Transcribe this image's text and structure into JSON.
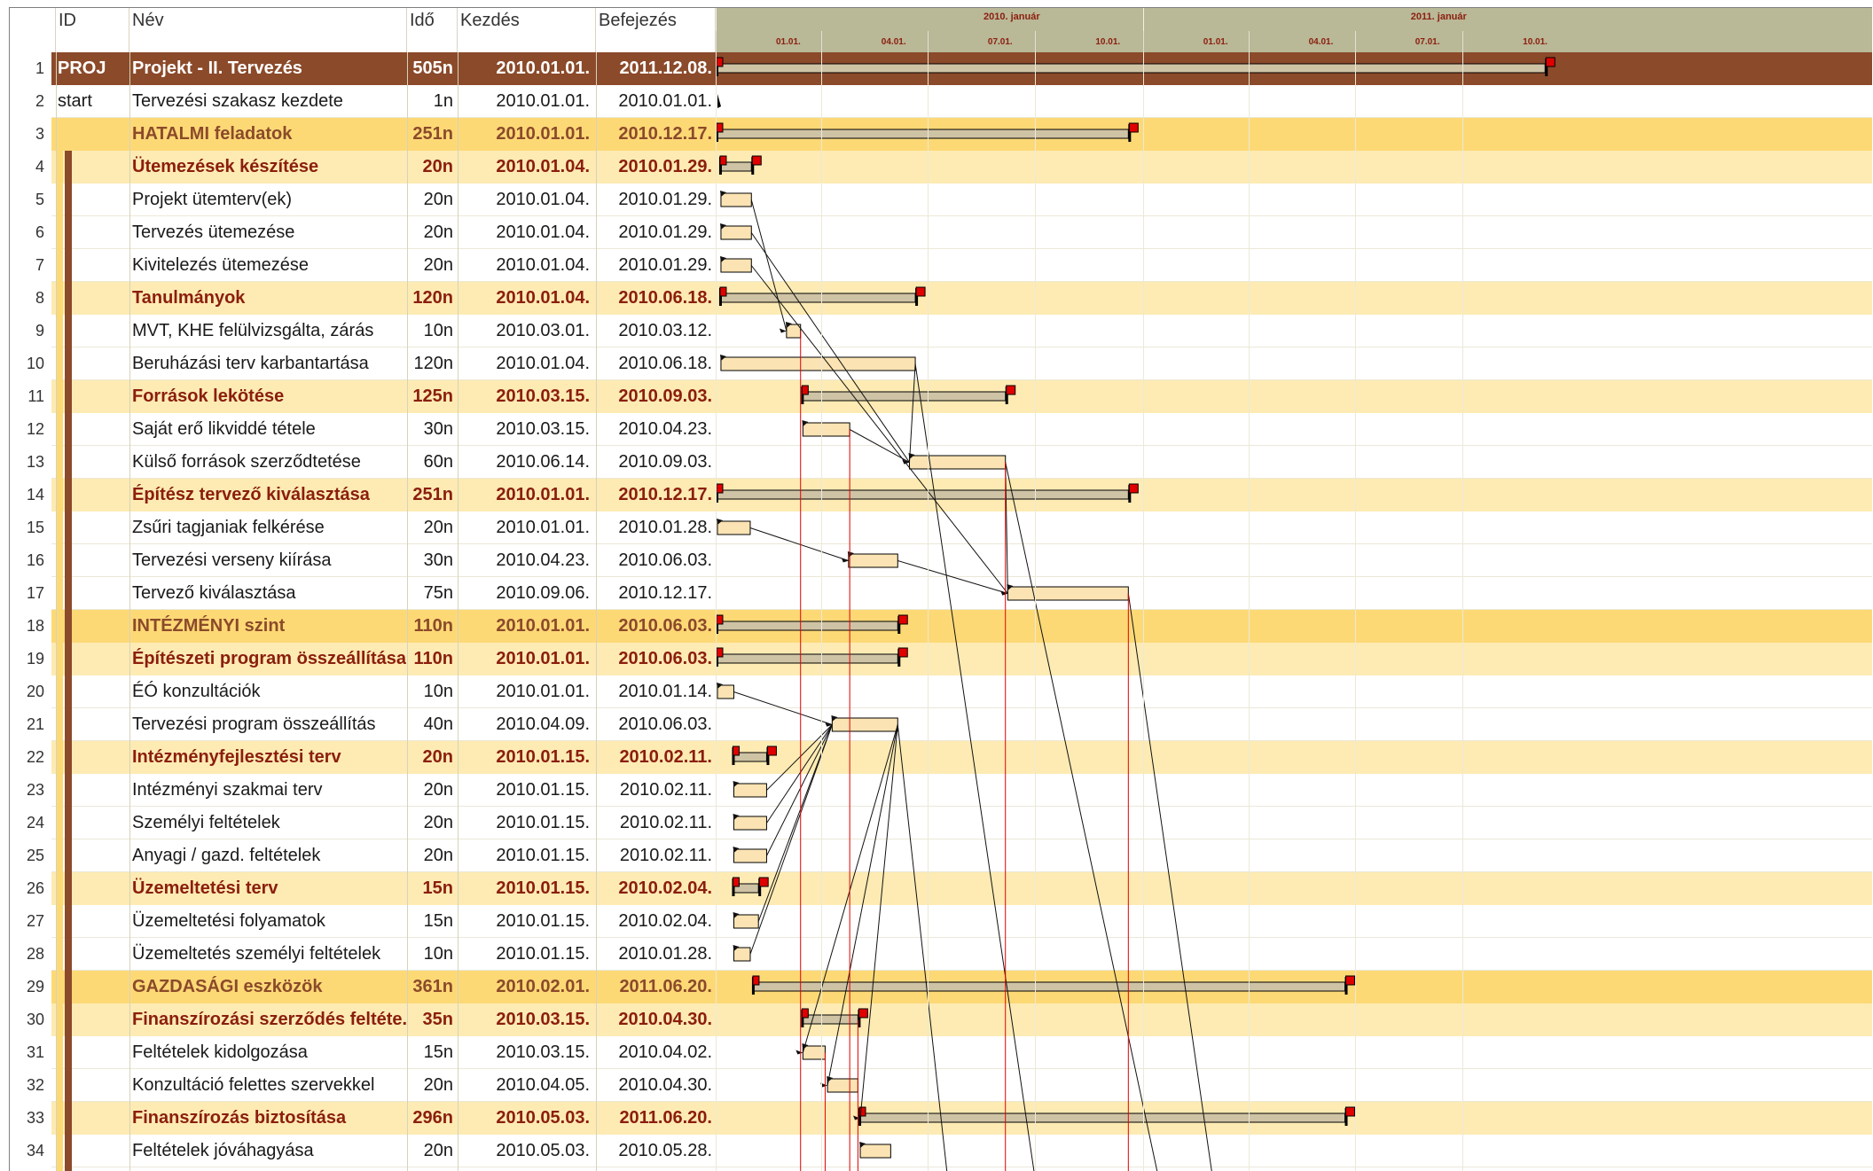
{
  "colors": {
    "project_row": "#8b4a2a",
    "main_group_row": "#fdd976",
    "sub_group_row": "#fdebb3",
    "sub_group_text": "#8b1e0e",
    "task_bar": "#fbe3b3",
    "summary_bar": "#cfc3a5",
    "milestone_flag": "#e00000",
    "timeline_bg": "#b9b897"
  },
  "header": {
    "id": "ID",
    "name": "Név",
    "duration": "Idő",
    "start": "Kezdés",
    "end": "Befejezés"
  },
  "timeline": {
    "years": [
      "2010. január",
      "2011. január"
    ],
    "months": [
      "01.01.",
      "04.01.",
      "07.01.",
      "10.01.",
      "01.01.",
      "04.01.",
      "07.01.",
      "10.01."
    ]
  },
  "rows": [
    {
      "num": "1",
      "id": "PROJ",
      "name": "Projekt - II. Tervezés",
      "dur": "505n",
      "start": "2010.01.01.",
      "end": "2011.12.08.",
      "type": "project"
    },
    {
      "num": "2",
      "id": "start",
      "name": "Tervezési szakasz kezdete",
      "dur": "1n",
      "start": "2010.01.01.",
      "end": "2010.01.01.",
      "type": "milestone"
    },
    {
      "num": "3",
      "id": "",
      "name": "HATALMI feladatok",
      "dur": "251n",
      "start": "2010.01.01.",
      "end": "2010.12.17.",
      "type": "main"
    },
    {
      "num": "4",
      "id": "",
      "name": "Ütemezések készítése",
      "dur": "20n",
      "start": "2010.01.04.",
      "end": "2010.01.29.",
      "type": "sub"
    },
    {
      "num": "5",
      "id": "",
      "name": "Projekt ütemterv(ek)",
      "dur": "20n",
      "start": "2010.01.04.",
      "end": "2010.01.29.",
      "type": "task"
    },
    {
      "num": "6",
      "id": "",
      "name": "Tervezés ütemezése",
      "dur": "20n",
      "start": "2010.01.04.",
      "end": "2010.01.29.",
      "type": "task"
    },
    {
      "num": "7",
      "id": "",
      "name": "Kivitelezés ütemezése",
      "dur": "20n",
      "start": "2010.01.04.",
      "end": "2010.01.29.",
      "type": "task"
    },
    {
      "num": "8",
      "id": "",
      "name": "Tanulmányok",
      "dur": "120n",
      "start": "2010.01.04.",
      "end": "2010.06.18.",
      "type": "sub"
    },
    {
      "num": "9",
      "id": "",
      "name": "MVT, KHE felülvizsgálta, zárás",
      "dur": "10n",
      "start": "2010.03.01.",
      "end": "2010.03.12.",
      "type": "task"
    },
    {
      "num": "10",
      "id": "",
      "name": "Beruházási terv karbantartása",
      "dur": "120n",
      "start": "2010.01.04.",
      "end": "2010.06.18.",
      "type": "task"
    },
    {
      "num": "11",
      "id": "",
      "name": "Források lekötése",
      "dur": "125n",
      "start": "2010.03.15.",
      "end": "2010.09.03.",
      "type": "sub"
    },
    {
      "num": "12",
      "id": "",
      "name": "Saját erő likviddé tétele",
      "dur": "30n",
      "start": "2010.03.15.",
      "end": "2010.04.23.",
      "type": "task"
    },
    {
      "num": "13",
      "id": "",
      "name": "Külső források szerződtetése",
      "dur": "60n",
      "start": "2010.06.14.",
      "end": "2010.09.03.",
      "type": "task"
    },
    {
      "num": "14",
      "id": "",
      "name": "Építész tervező kiválasztása",
      "dur": "251n",
      "start": "2010.01.01.",
      "end": "2010.12.17.",
      "type": "sub"
    },
    {
      "num": "15",
      "id": "",
      "name": "Zsűri tagjaniak felkérése",
      "dur": "20n",
      "start": "2010.01.01.",
      "end": "2010.01.28.",
      "type": "task"
    },
    {
      "num": "16",
      "id": "",
      "name": "Tervezési verseny kiírása",
      "dur": "30n",
      "start": "2010.04.23.",
      "end": "2010.06.03.",
      "type": "task"
    },
    {
      "num": "17",
      "id": "",
      "name": "Tervező kiválasztása",
      "dur": "75n",
      "start": "2010.09.06.",
      "end": "2010.12.17.",
      "type": "task"
    },
    {
      "num": "18",
      "id": "",
      "name": "INTÉZMÉNYI szint",
      "dur": "110n",
      "start": "2010.01.01.",
      "end": "2010.06.03.",
      "type": "main"
    },
    {
      "num": "19",
      "id": "",
      "name": "Építészeti program összeállítása",
      "dur": "110n",
      "start": "2010.01.01.",
      "end": "2010.06.03.",
      "type": "sub"
    },
    {
      "num": "20",
      "id": "",
      "name": "ÉÓ konzultációk",
      "dur": "10n",
      "start": "2010.01.01.",
      "end": "2010.01.14.",
      "type": "task"
    },
    {
      "num": "21",
      "id": "",
      "name": "Tervezési program összeállítás",
      "dur": "40n",
      "start": "2010.04.09.",
      "end": "2010.06.03.",
      "type": "task"
    },
    {
      "num": "22",
      "id": "",
      "name": "Intézményfejlesztési terv",
      "dur": "20n",
      "start": "2010.01.15.",
      "end": "2010.02.11.",
      "type": "sub"
    },
    {
      "num": "23",
      "id": "",
      "name": "Intézményi szakmai terv",
      "dur": "20n",
      "start": "2010.01.15.",
      "end": "2010.02.11.",
      "type": "task"
    },
    {
      "num": "24",
      "id": "",
      "name": "Személyi feltételek",
      "dur": "20n",
      "start": "2010.01.15.",
      "end": "2010.02.11.",
      "type": "task"
    },
    {
      "num": "25",
      "id": "",
      "name": "Anyagi / gazd. feltételek",
      "dur": "20n",
      "start": "2010.01.15.",
      "end": "2010.02.11.",
      "type": "task"
    },
    {
      "num": "26",
      "id": "",
      "name": "Üzemeltetési terv",
      "dur": "15n",
      "start": "2010.01.15.",
      "end": "2010.02.04.",
      "type": "sub"
    },
    {
      "num": "27",
      "id": "",
      "name": "Üzemeltetési folyamatok",
      "dur": "15n",
      "start": "2010.01.15.",
      "end": "2010.02.04.",
      "type": "task"
    },
    {
      "num": "28",
      "id": "",
      "name": "Üzemeltetés személyi feltételek",
      "dur": "10n",
      "start": "2010.01.15.",
      "end": "2010.01.28.",
      "type": "task"
    },
    {
      "num": "29",
      "id": "",
      "name": "GAZDASÁGI eszközök",
      "dur": "361n",
      "start": "2010.02.01.",
      "end": "2011.06.20.",
      "type": "main"
    },
    {
      "num": "30",
      "id": "",
      "name": "Finanszírozási szerződés feltéte...",
      "dur": "35n",
      "start": "2010.03.15.",
      "end": "2010.04.30.",
      "type": "sub"
    },
    {
      "num": "31",
      "id": "",
      "name": "Feltételek kidolgozása",
      "dur": "15n",
      "start": "2010.03.15.",
      "end": "2010.04.02.",
      "type": "task"
    },
    {
      "num": "32",
      "id": "",
      "name": "Konzultáció felettes szervekkel",
      "dur": "20n",
      "start": "2010.04.05.",
      "end": "2010.04.30.",
      "type": "task"
    },
    {
      "num": "33",
      "id": "",
      "name": "Finanszírozás biztosítása",
      "dur": "296n",
      "start": "2010.05.03.",
      "end": "2011.06.20.",
      "type": "sub"
    },
    {
      "num": "34",
      "id": "",
      "name": "Feltételek jóváhagyása",
      "dur": "20n",
      "start": "2010.05.03.",
      "end": "2010.05.28.",
      "type": "task"
    }
  ]
}
